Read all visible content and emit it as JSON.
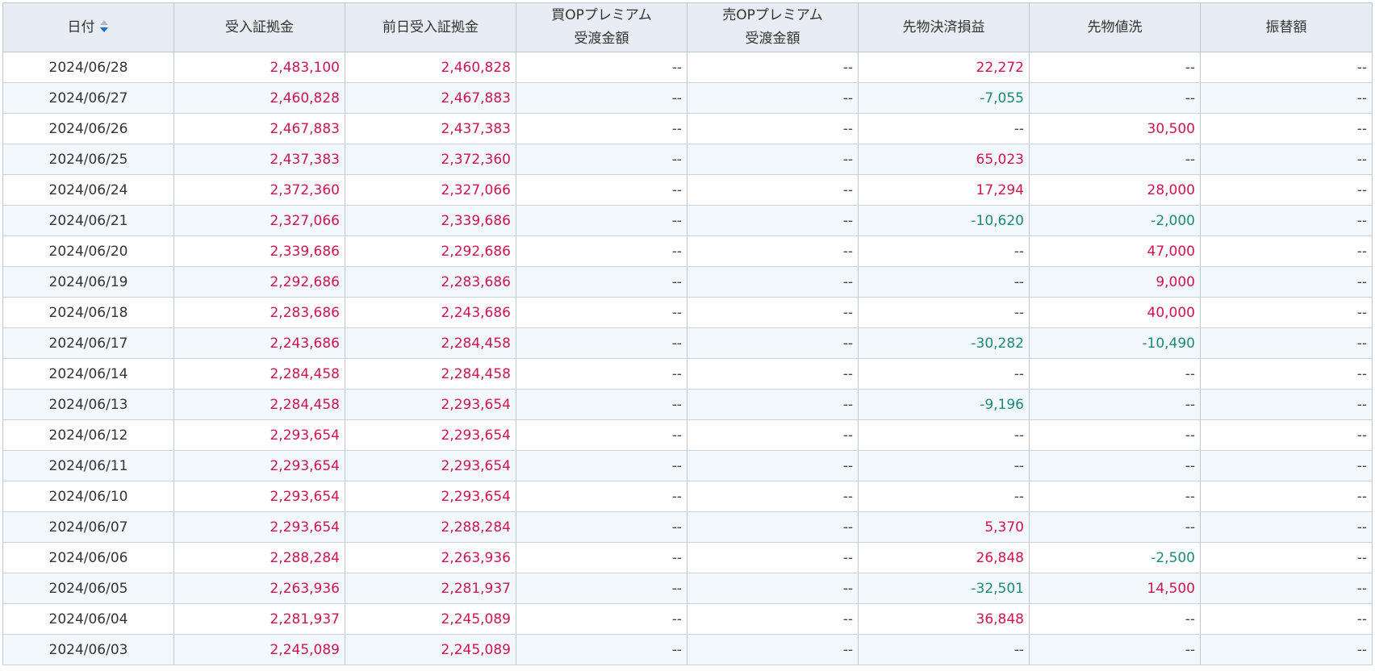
{
  "colors": {
    "header_bg": "#e8edf4",
    "border": "#bcc7d6",
    "row_alt_bg": "#f3f8fc",
    "positive": "#d1144e",
    "negative": "#1a8a78",
    "sort_active": "#1f6fd0"
  },
  "table": {
    "sort_icon": "sort-descending-icon",
    "headers": [
      {
        "lines": [
          "日付"
        ],
        "sortable": true
      },
      {
        "lines": [
          "受入証拠金"
        ]
      },
      {
        "lines": [
          "前日受入証拠金"
        ]
      },
      {
        "lines": [
          "買OPプレミアム",
          "受渡金額"
        ]
      },
      {
        "lines": [
          "売OPプレミアム",
          "受渡金額"
        ]
      },
      {
        "lines": [
          "先物決済損益"
        ]
      },
      {
        "lines": [
          "先物値洗"
        ]
      },
      {
        "lines": [
          "振替額"
        ]
      }
    ],
    "rows": [
      [
        "2024/06/28",
        "2,483,100",
        "2,460,828",
        "--",
        "--",
        "22,272",
        "--",
        "--"
      ],
      [
        "2024/06/27",
        "2,460,828",
        "2,467,883",
        "--",
        "--",
        "-7,055",
        "--",
        "--"
      ],
      [
        "2024/06/26",
        "2,467,883",
        "2,437,383",
        "--",
        "--",
        "--",
        "30,500",
        "--"
      ],
      [
        "2024/06/25",
        "2,437,383",
        "2,372,360",
        "--",
        "--",
        "65,023",
        "--",
        "--"
      ],
      [
        "2024/06/24",
        "2,372,360",
        "2,327,066",
        "--",
        "--",
        "17,294",
        "28,000",
        "--"
      ],
      [
        "2024/06/21",
        "2,327,066",
        "2,339,686",
        "--",
        "--",
        "-10,620",
        "-2,000",
        "--"
      ],
      [
        "2024/06/20",
        "2,339,686",
        "2,292,686",
        "--",
        "--",
        "--",
        "47,000",
        "--"
      ],
      [
        "2024/06/19",
        "2,292,686",
        "2,283,686",
        "--",
        "--",
        "--",
        "9,000",
        "--"
      ],
      [
        "2024/06/18",
        "2,283,686",
        "2,243,686",
        "--",
        "--",
        "--",
        "40,000",
        "--"
      ],
      [
        "2024/06/17",
        "2,243,686",
        "2,284,458",
        "--",
        "--",
        "-30,282",
        "-10,490",
        "--"
      ],
      [
        "2024/06/14",
        "2,284,458",
        "2,284,458",
        "--",
        "--",
        "--",
        "--",
        "--"
      ],
      [
        "2024/06/13",
        "2,284,458",
        "2,293,654",
        "--",
        "--",
        "-9,196",
        "--",
        "--"
      ],
      [
        "2024/06/12",
        "2,293,654",
        "2,293,654",
        "--",
        "--",
        "--",
        "--",
        "--"
      ],
      [
        "2024/06/11",
        "2,293,654",
        "2,293,654",
        "--",
        "--",
        "--",
        "--",
        "--"
      ],
      [
        "2024/06/10",
        "2,293,654",
        "2,293,654",
        "--",
        "--",
        "--",
        "--",
        "--"
      ],
      [
        "2024/06/07",
        "2,293,654",
        "2,288,284",
        "--",
        "--",
        "5,370",
        "--",
        "--"
      ],
      [
        "2024/06/06",
        "2,288,284",
        "2,263,936",
        "--",
        "--",
        "26,848",
        "-2,500",
        "--"
      ],
      [
        "2024/06/05",
        "2,263,936",
        "2,281,937",
        "--",
        "--",
        "-32,501",
        "14,500",
        "--"
      ],
      [
        "2024/06/04",
        "2,281,937",
        "2,245,089",
        "--",
        "--",
        "36,848",
        "--",
        "--"
      ],
      [
        "2024/06/03",
        "2,245,089",
        "2,245,089",
        "--",
        "--",
        "--",
        "--",
        "--"
      ]
    ]
  }
}
